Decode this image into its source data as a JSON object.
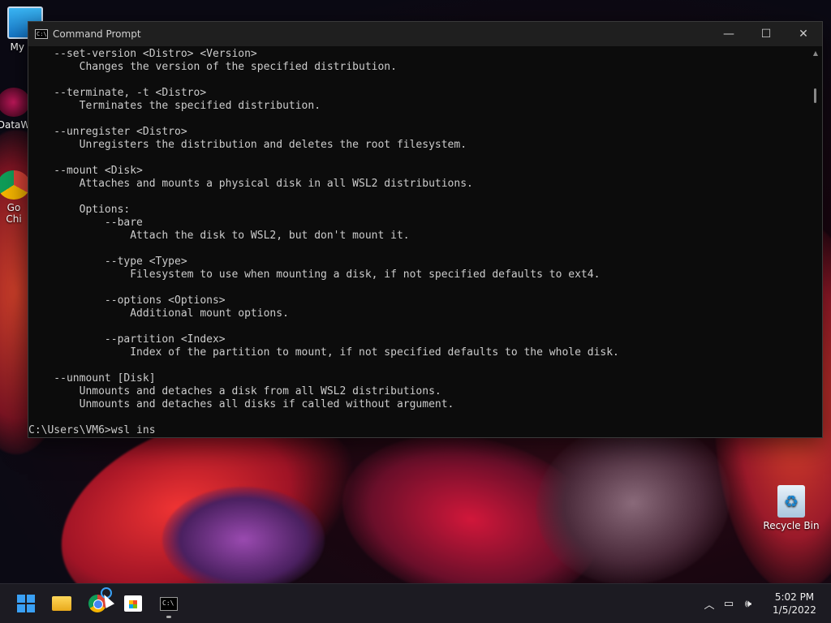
{
  "desktop": {
    "icons": [
      {
        "label": "My Co"
      },
      {
        "label": "DataW"
      },
      {
        "label": "Go\nChi"
      },
      {
        "label": "Recycle Bin"
      }
    ]
  },
  "window": {
    "title": "Command Prompt",
    "buttons": {
      "minimize": "—",
      "maximize": "☐",
      "close": "✕"
    }
  },
  "console": {
    "lines": [
      "    --set-version <Distro> <Version>",
      "        Changes the version of the specified distribution.",
      "",
      "    --terminate, -t <Distro>",
      "        Terminates the specified distribution.",
      "",
      "    --unregister <Distro>",
      "        Unregisters the distribution and deletes the root filesystem.",
      "",
      "    --mount <Disk>",
      "        Attaches and mounts a physical disk in all WSL2 distributions.",
      "",
      "        Options:",
      "            --bare",
      "                Attach the disk to WSL2, but don't mount it.",
      "",
      "            --type <Type>",
      "                Filesystem to use when mounting a disk, if not specified defaults to ext4.",
      "",
      "            --options <Options>",
      "                Additional mount options.",
      "",
      "            --partition <Index>",
      "                Index of the partition to mount, if not specified defaults to the whole disk.",
      "",
      "    --unmount [Disk]",
      "        Unmounts and detaches a disk from all WSL2 distributions.",
      "        Unmounts and detaches all disks if called without argument.",
      "",
      "C:\\Users\\VM6>wsl ins"
    ]
  },
  "taskbar": {
    "time": "5:02 PM",
    "date": "1/5/2022"
  }
}
